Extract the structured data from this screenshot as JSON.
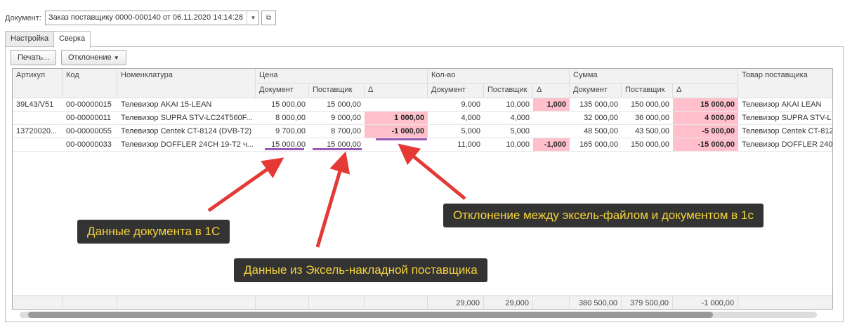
{
  "document": {
    "label": "Документ:",
    "value": "Заказ поставщику 0000-000140 от 06.11.2020 14:14:28"
  },
  "tabs": [
    "Настройка",
    "Сверка"
  ],
  "toolbar": {
    "print": "Печать...",
    "deviation": "Отклонение"
  },
  "headers": {
    "article": "Артикул",
    "code": "Код",
    "nomenclature": "Номенклатура",
    "price": "Цена",
    "qty": "Кол-во",
    "sum": "Сумма",
    "supplier_item": "Товар поставщика",
    "doc": "Документ",
    "supplier": "Поставщик",
    "delta": "Δ"
  },
  "rows": [
    [
      "39L43/V51",
      "00-00000015",
      "Телевизор AKAI 15-LEAN",
      "15 000,00",
      "15 000,00",
      "",
      "9,000",
      "10,000",
      "1,000",
      "135 000,00",
      "150 000,00",
      "15 000,00",
      "Телевизор AKAI LEAN"
    ],
    [
      "",
      "00-00000011",
      "Телевизор SUPRA STV-LC24T560F...",
      "8 000,00",
      "9 000,00",
      "1 000,00",
      "4,000",
      "4,000",
      "",
      "32 000,00",
      "36 000,00",
      "4 000,00",
      "Телевизор SUPRA STV-L"
    ],
    [
      "13720020...",
      "00-00000055",
      "Телевизор Centek CT-8124 (DVB-T2)",
      "9 700,00",
      "8 700,00",
      "-1 000,00",
      "5,000",
      "5,000",
      "",
      "48 500,00",
      "43 500,00",
      "-5 000,00",
      "Телевизор Centek CT-812"
    ],
    [
      "",
      "00-00000033",
      "Телевизор DOFFLER 24CH 19-T2 ч...",
      "15 000,00",
      "15 000,00",
      "",
      "11,000",
      "10,000",
      "-1,000",
      "165 000,00",
      "150 000,00",
      "-15 000,00",
      "Телевизор DOFFLER 240"
    ]
  ],
  "totals": [
    "",
    "",
    "",
    "",
    "",
    "",
    "29,000",
    "29,000",
    "",
    "380 500,00",
    "379 500,00",
    "-1 000,00",
    ""
  ],
  "callouts": [
    "Данные документа в 1С",
    "Данные из Эксель-накладной поставщика",
    "Отклонение между эксель-файлом и документом в 1с"
  ],
  "colors": {
    "highlight": "#ffc0cb",
    "callout_bg": "#333333",
    "callout_text": "#f6d43a",
    "arrow": "#e53935",
    "underline": "#9b59b6"
  }
}
